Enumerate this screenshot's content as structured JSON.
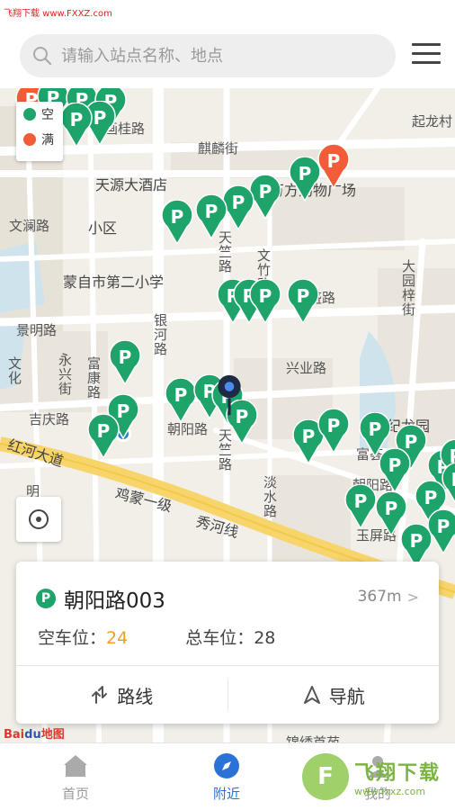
{
  "watermark": "飞翔下载 www.FXXZ.com",
  "search": {
    "placeholder": "请输入站点名称、地点"
  },
  "legend": {
    "empty": {
      "label": "空",
      "color": "#1ea36b"
    },
    "full": {
      "label": "满",
      "color": "#f25c38"
    }
  },
  "map": {
    "labels": {
      "qilonglu": "起龙村",
      "hongguijie": "画桂路",
      "qilinjie": "麒麟街",
      "tianyuan_hotel": "天源大酒店",
      "wanfang_plaza": "万方购物广场",
      "wenlanlu": "文澜路",
      "xiaoqu": "小区",
      "mengzi_school": "蒙自市第二小学",
      "tianzhulu": "天竺路",
      "wenzhulu": "文竹路",
      "yinhelu": "银河路",
      "jingminglu": "景明路",
      "xingshenglu": "兴盛路",
      "xingyelu": "兴业路",
      "dayuanzijie": "大园梓街",
      "yongxingjie": "永兴街",
      "fukanglu": "富康路",
      "jiqinglu": "吉庆路",
      "chaoyanglu": "朝阳路",
      "tianzhulu2": "天竺路",
      "jilongyuan": "纪龙园",
      "honghedadao": "红河大道",
      "jimengyiji": "鸡蒙一级",
      "xiuhexian": "秀河线",
      "danshuilu": "淡水路",
      "fuhuilu": "富荟",
      "chaoyanglu2": "朝阳路",
      "yupinglu": "玉屏路",
      "wenhua": "文化",
      "ming": "明",
      "jinxiu": "锦绣首苑"
    }
  },
  "card": {
    "name": "朝阳路003",
    "distance": "367m",
    "free_label": "空车位：",
    "free_value": "24",
    "total_label": "总车位：",
    "total_value": "28",
    "route_label": "路线",
    "nav_label": "导航"
  },
  "map_logo": {
    "bai": "Bai",
    "du": "du",
    "text": "地图"
  },
  "tabs": [
    {
      "label": "首页",
      "icon": "home-icon"
    },
    {
      "label": "附近",
      "icon": "compass-icon"
    },
    {
      "label": "我的",
      "icon": "user-icon"
    }
  ],
  "site_badge": {
    "title": "飞翔下载",
    "url": "www.fxxz.com"
  },
  "colors": {
    "accent": "#2b72d8",
    "pin_green": "#1ea36b",
    "pin_red": "#f25c38",
    "warning": "#f0a020"
  }
}
